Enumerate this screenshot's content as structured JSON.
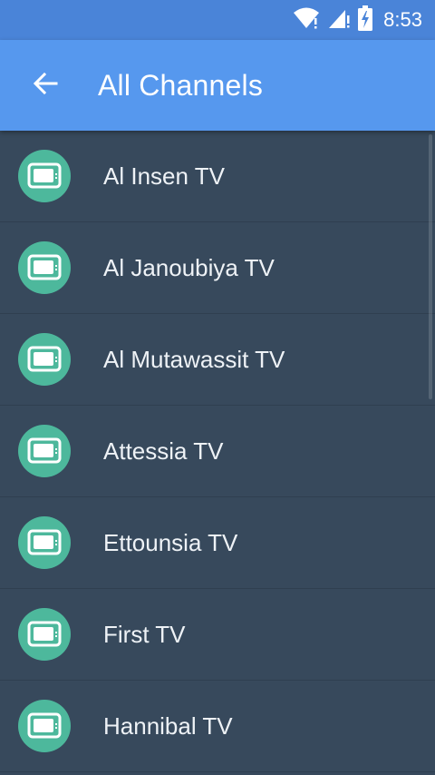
{
  "status_bar": {
    "time": "8:53",
    "icons": [
      "wifi-icon",
      "cell-signal-icon",
      "battery-charging-icon"
    ]
  },
  "app_bar": {
    "title": "All Channels",
    "back_icon": "arrow-left-icon"
  },
  "channels": [
    {
      "label": "Al Insen TV",
      "icon": "tv-icon"
    },
    {
      "label": "Al Janoubiya TV",
      "icon": "tv-icon"
    },
    {
      "label": "Al Mutawassit TV",
      "icon": "tv-icon"
    },
    {
      "label": "Attessia TV",
      "icon": "tv-icon"
    },
    {
      "label": "Ettounsia TV",
      "icon": "tv-icon"
    },
    {
      "label": "First TV",
      "icon": "tv-icon"
    },
    {
      "label": "Hannibal TV",
      "icon": "tv-icon"
    }
  ],
  "colors": {
    "status_bar": "#4a84d8",
    "app_bar": "#5698ee",
    "background": "#37495c",
    "icon_circle": "#4db89c"
  }
}
